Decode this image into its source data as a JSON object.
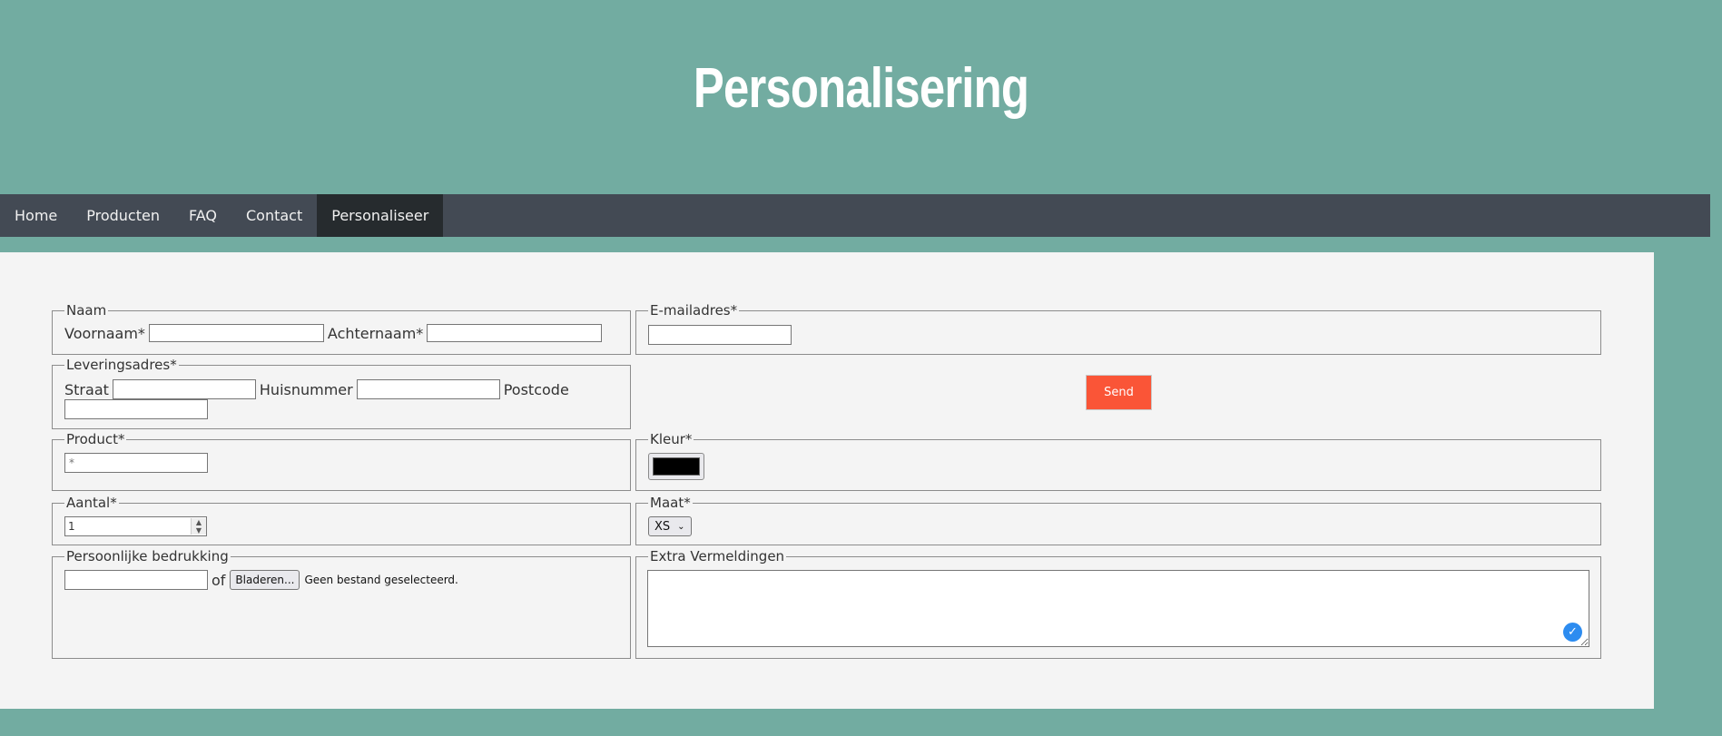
{
  "header": {
    "title": "Personalisering"
  },
  "nav": {
    "items": [
      {
        "label": "Home"
      },
      {
        "label": "Producten"
      },
      {
        "label": "FAQ"
      },
      {
        "label": "Contact"
      },
      {
        "label": "Personaliseer"
      }
    ],
    "active": "Personaliseer"
  },
  "form": {
    "naam": {
      "legend": "Naam",
      "voornaam_label": "Voornaam*",
      "achternaam_label": "Achternaam*"
    },
    "email": {
      "legend": "E-mailadres*"
    },
    "adres": {
      "legend": "Leveringsadres*",
      "straat_label": "Straat",
      "huisnummer_label": "Huisnummer",
      "postcode_label": "Postcode"
    },
    "send_label": "Send",
    "product": {
      "legend": "Product*",
      "placeholder": "*"
    },
    "kleur": {
      "legend": "Kleur*",
      "value": "#000000"
    },
    "aantal": {
      "legend": "Aantal*",
      "value": "1"
    },
    "maat": {
      "legend": "Maat*",
      "selected": "XS"
    },
    "bedrukking": {
      "legend": "Persoonlijke bedrukking",
      "of_label": "of",
      "browse_label": "Bladeren...",
      "no_file_text": "Geen bestand geselecteerd."
    },
    "extra": {
      "legend": "Extra Vermeldingen"
    }
  },
  "colors": {
    "background": "#72aca1",
    "nav": "#434a54",
    "nav_active": "#262b2e",
    "panel": "#f4f4f4",
    "send_button": "#fa5537"
  }
}
